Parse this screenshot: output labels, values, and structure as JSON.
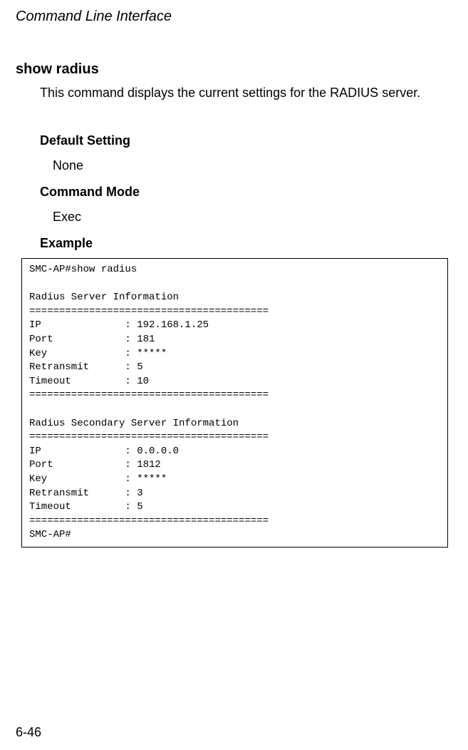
{
  "header": "Command Line Interface",
  "command": {
    "title": "show radius",
    "description": "This command displays the current settings for the RADIUS server."
  },
  "sections": {
    "default_setting": {
      "label": "Default Setting",
      "value": "None"
    },
    "command_mode": {
      "label": "Command Mode",
      "value": "Exec"
    },
    "example": {
      "label": "Example"
    }
  },
  "example_output": "SMC-AP#show radius\n\nRadius Server Information\n========================================\nIP              : 192.168.1.25\nPort            : 181\nKey             : *****\nRetransmit      : 5\nTimeout         : 10\n========================================\n\nRadius Secondary Server Information\n========================================\nIP              : 0.0.0.0\nPort            : 1812\nKey             : *****\nRetransmit      : 3\nTimeout         : 5\n========================================\nSMC-AP#",
  "page_number": "6-46"
}
